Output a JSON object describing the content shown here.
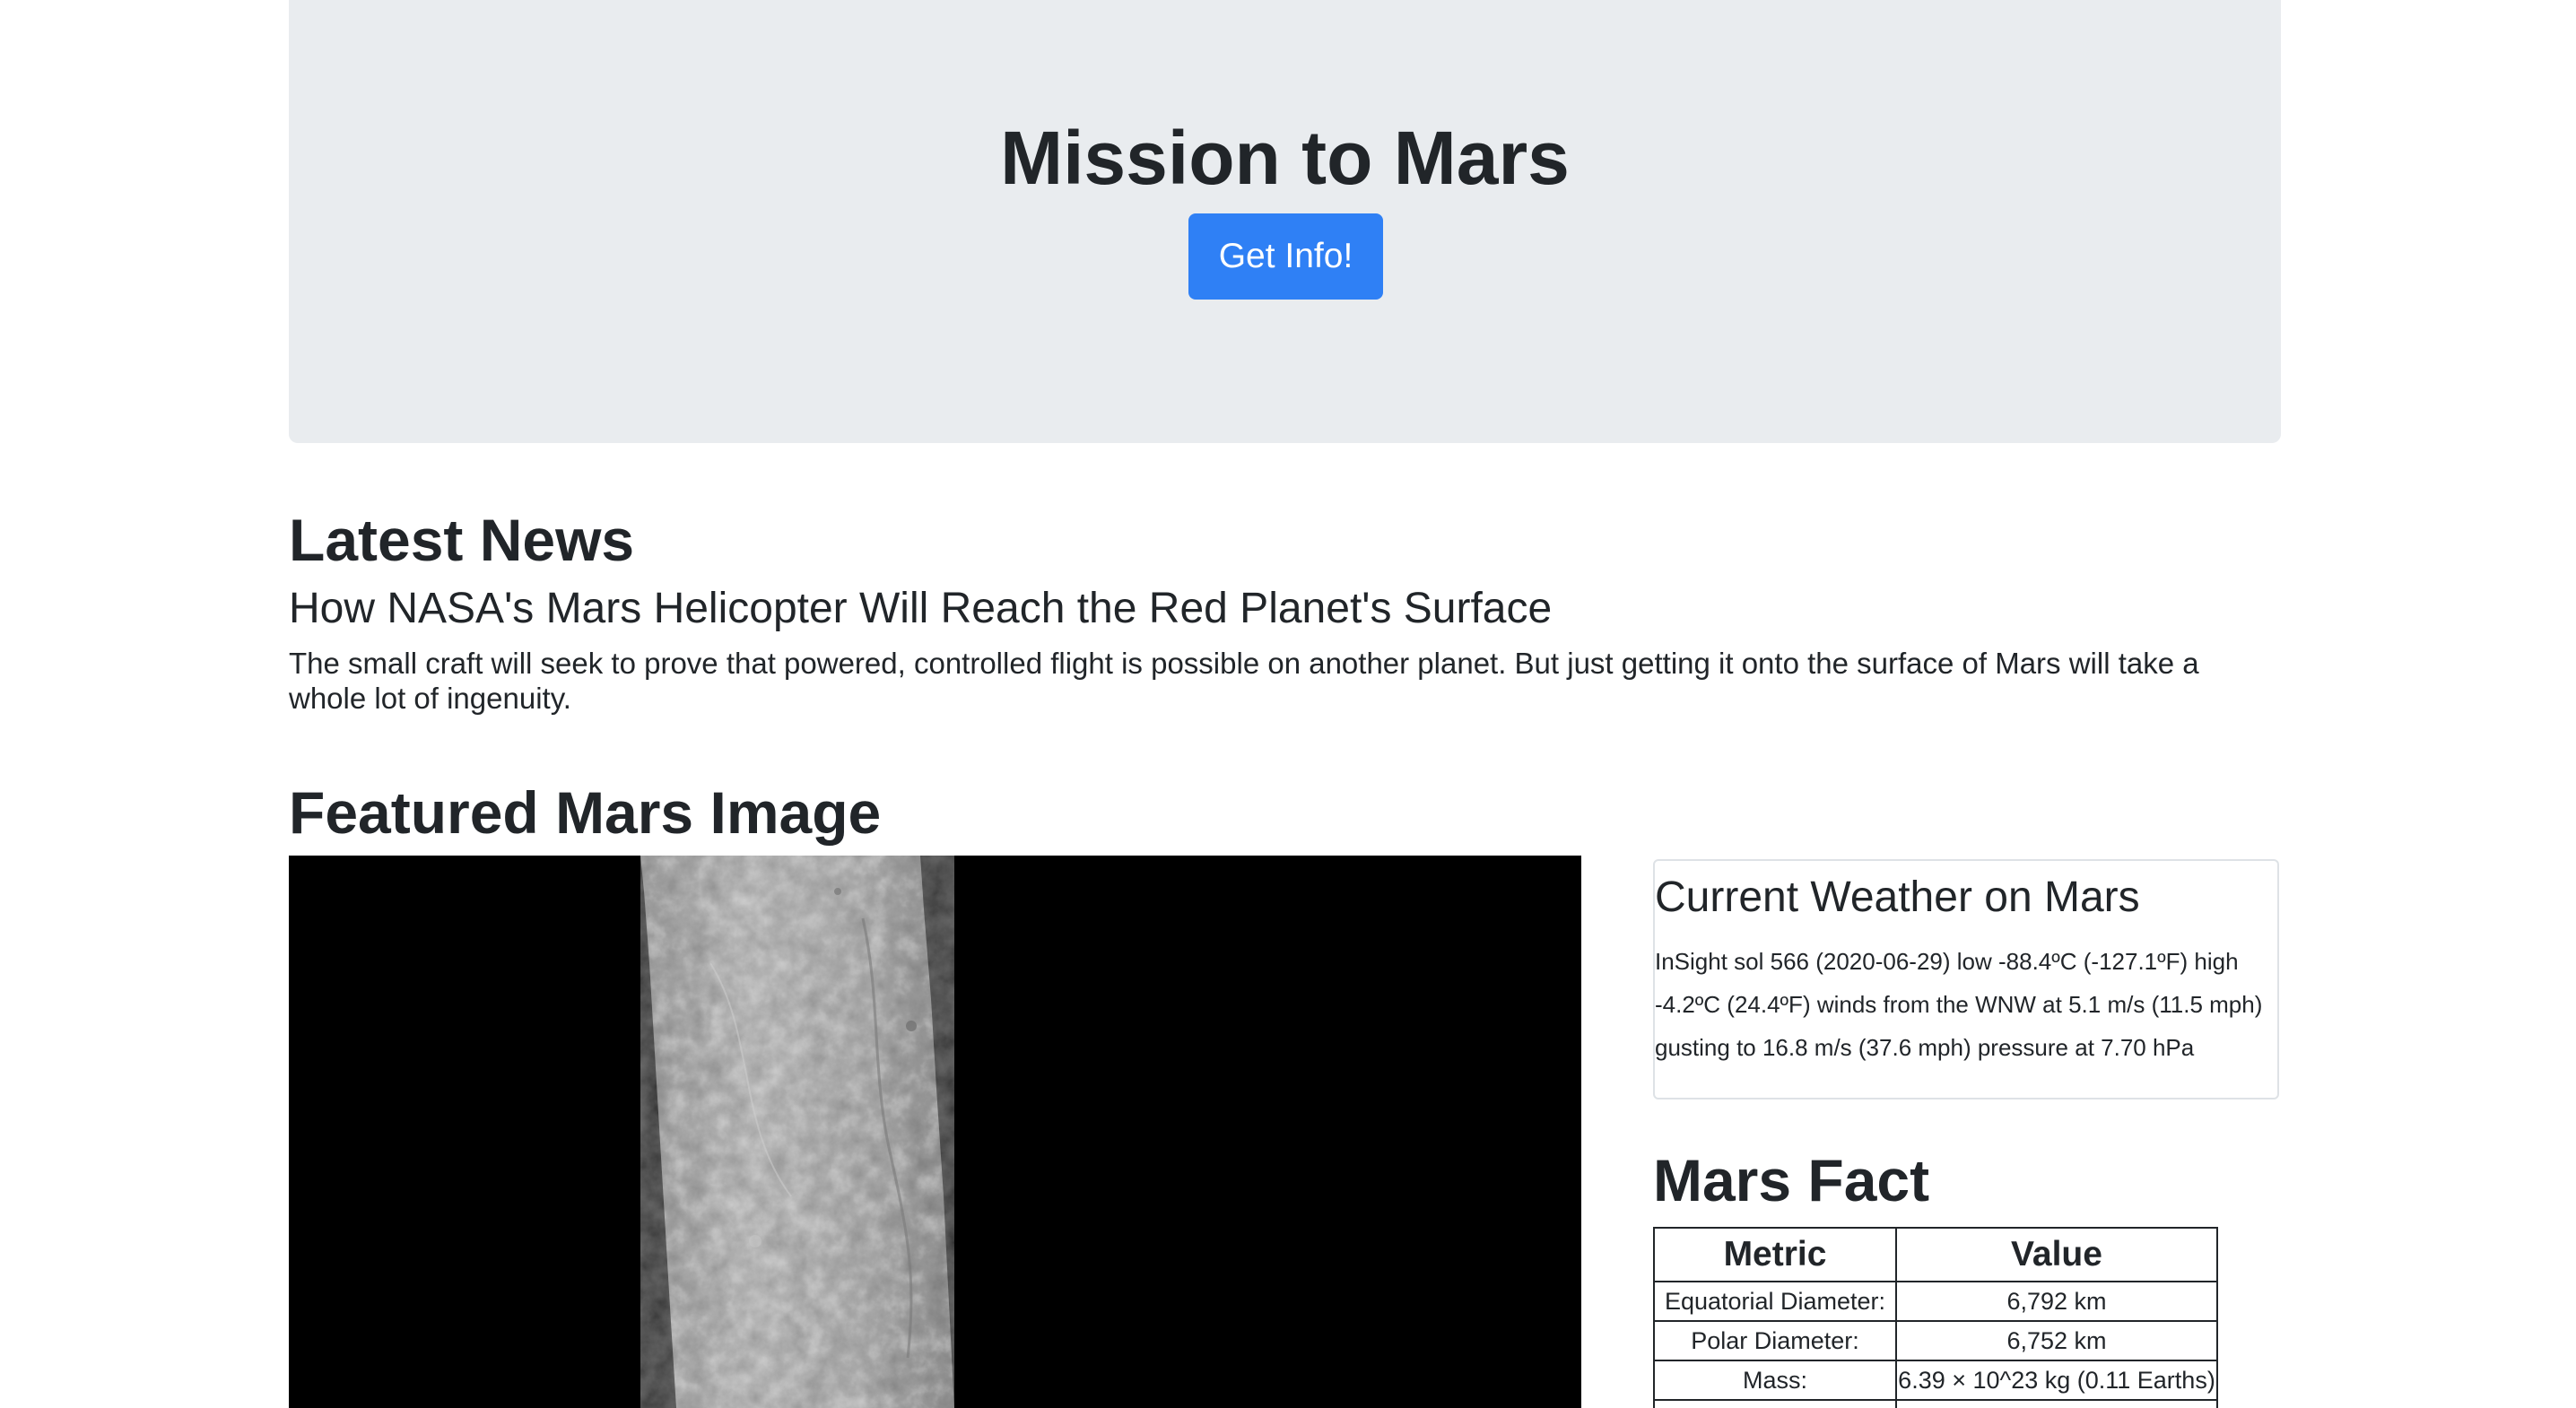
{
  "header": {
    "title": "Mission to Mars",
    "button_label": "Get Info!"
  },
  "news": {
    "heading": "Latest News",
    "title": "How NASA's Mars Helicopter Will Reach the Red Planet's Surface",
    "teaser": "The small craft will seek to prove that powered, controlled flight is possible on another planet. But just getting it onto the surface of Mars will take a whole lot of ingenuity."
  },
  "featured": {
    "heading": "Featured Mars Image"
  },
  "weather": {
    "heading": "Current Weather on Mars",
    "text": "InSight sol 566 (2020-06-29) low -88.4ºC (-127.1ºF) high -4.2ºC (24.4ºF) winds from the WNW at 5.1 m/s (11.5 mph) gusting to 16.8 m/s (37.6 mph) pressure at 7.70 hPa"
  },
  "facts": {
    "heading": "Mars Fact",
    "columns": [
      "Metric",
      "Value"
    ],
    "rows": [
      [
        "Equatorial Diameter:",
        "6,792 km"
      ],
      [
        "Polar Diameter:",
        "6,752 km"
      ],
      [
        "Mass:",
        "6.39 × 10^23 kg (0.11 Earths)"
      ]
    ]
  },
  "colors": {
    "jumbotron_bg": "#e9ecef",
    "button_bg": "#2f80f5",
    "text": "#212529"
  }
}
